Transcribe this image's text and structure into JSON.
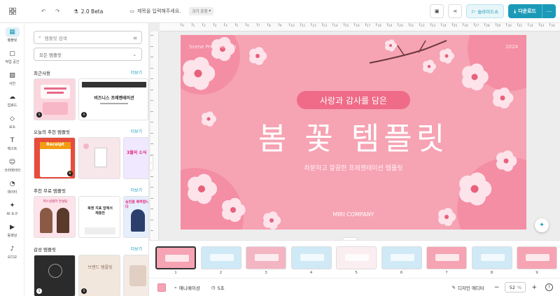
{
  "topbar": {
    "version": "2.0 Beta",
    "title_placeholder": "제목을 입력해주세요.",
    "size_chip": "크기 조정",
    "slideshow_label": "슬라이드쇼",
    "download_label": "다운로드"
  },
  "rail": {
    "items": [
      {
        "label": "템플릿",
        "icon": "template-icon"
      },
      {
        "label": "작업 공간",
        "icon": "workspace-icon"
      },
      {
        "label": "사진",
        "icon": "photo-icon"
      },
      {
        "label": "업로드",
        "icon": "upload-icon"
      },
      {
        "label": "요소",
        "icon": "elements-icon"
      },
      {
        "label": "텍스트",
        "icon": "text-icon"
      },
      {
        "label": "크리에이터",
        "icon": "creator-icon"
      },
      {
        "label": "데이터",
        "icon": "data-icon"
      },
      {
        "label": "AI 도구",
        "icon": "ai-tools-icon"
      },
      {
        "label": "동영상",
        "icon": "video-icon"
      },
      {
        "label": "오디오",
        "icon": "audio-icon"
      }
    ]
  },
  "panel": {
    "search_placeholder": "템플릿 검색",
    "select_value": "모든 템플릿",
    "more_label": "더보기",
    "sections": [
      {
        "title": "최근사용",
        "thumbs": [
          {
            "badge": "S",
            "text": "",
            "bg": "#fbd6df"
          },
          {
            "badge": "S",
            "text": "비즈니스 프레젠테이션",
            "bg": "#ffffff"
          }
        ]
      },
      {
        "title": "오늘의 추천 템플릿",
        "thumbs": [
          {
            "badge": "",
            "text": "Receipt",
            "bg": "#e74c3c"
          },
          {
            "badge": "",
            "text": "",
            "bg": "#f7e6ea"
          },
          {
            "badge": "",
            "text": "3월의 소식",
            "bg": "#efe8ff"
          }
        ]
      },
      {
        "title": "추천 무료 템플릿",
        "thumbs": [
          {
            "badge": "",
            "text": "퍼스널컬러 컨설팅",
            "bg": "#fde4ea"
          },
          {
            "badge": "",
            "text": "북엔 지표 앞에서 재충전",
            "bg": "#ffffff"
          },
          {
            "badge": "",
            "text": "승진을 축하합니다",
            "bg": "#e6eefc"
          }
        ]
      },
      {
        "title": "감성 템플릿",
        "thumbs": [
          {
            "badge": "S",
            "text": "",
            "bg": "#2b2b2b"
          },
          {
            "badge": "S",
            "text": "브랜드 템플릿",
            "bg": "#f2e7dd"
          },
          {
            "badge": "",
            "text": "",
            "bg": "#f4ebe4"
          }
        ]
      }
    ]
  },
  "slide": {
    "top_left": "Scene Presentation",
    "top_right": "2024",
    "pill": "사랑과 감사를 담은",
    "title": "봄 꽃 템플릿",
    "subtitle": "차분하고 깔끔한 프레젠테이션 템플릿",
    "company": "MIRI COMPANY",
    "bg": "#f6a3b3",
    "accent": "#ef6b87"
  },
  "filmstrip": {
    "thumbs": [
      {
        "num": "1",
        "bg": "#f6a3b3"
      },
      {
        "num": "2",
        "bg": "#cfe9f7"
      },
      {
        "num": "3",
        "bg": "#f4b5c3"
      },
      {
        "num": "4",
        "bg": "#cfe9f7"
      },
      {
        "num": "5",
        "bg": "#fbeef1"
      },
      {
        "num": "6",
        "bg": "#cfe9f7"
      },
      {
        "num": "7",
        "bg": "#f6a3b3"
      },
      {
        "num": "8",
        "bg": "#cfe9f7"
      },
      {
        "num": "9",
        "bg": "#f6a3b3"
      }
    ]
  },
  "bottombar": {
    "animation_label": "애니메이션",
    "duration_label": "5초",
    "design_editor_label": "디자인 에디터",
    "zoom_value": "52",
    "zoom_unit": "%",
    "minus": "−",
    "plus": "+"
  },
  "ruler": {
    "labels": [
      "0",
      "1",
      "2",
      "3",
      "4",
      "5",
      "6",
      "7",
      "8",
      "9",
      "10",
      "11",
      "12",
      "13",
      "14",
      "15",
      "16",
      "17",
      "18",
      "19",
      "20",
      "21",
      "22",
      "23",
      "24",
      "25",
      "26",
      "27",
      "28",
      "29",
      "30",
      "31",
      "32",
      "33",
      "34",
      "35"
    ]
  }
}
